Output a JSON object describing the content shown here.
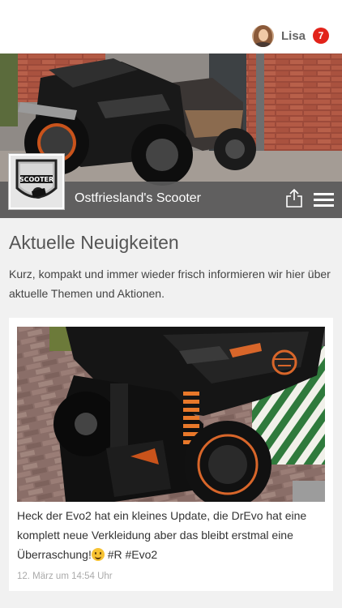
{
  "header": {
    "user_name": "Lisa",
    "notification_count": "7"
  },
  "page": {
    "name": "Ostfriesland's Scooter",
    "logo_text": "SCOOTER"
  },
  "news": {
    "title": "Aktuelle Neuigkeiten",
    "description": "Kurz, kompakt und immer wieder frisch informieren wir hier über aktuelle Themen und Aktionen."
  },
  "posts": [
    {
      "text_before_emoji": "Heck der Evo2 hat ein kleines Update, die DrEvo hat eine komplett neue Verkleidung aber das bleibt erstmal eine Überraschung!",
      "text_after_emoji": " #R #Evo2",
      "date": "12. März um 14:54 Uhr"
    }
  ],
  "colors": {
    "badge": "#e2231a",
    "cover_bar": "#5a5a5a",
    "background": "#f1f1f1"
  },
  "icons": {
    "share": "share-icon",
    "menu": "hamburger-menu-icon",
    "avatar": "avatar-image",
    "emoji": "smiling-face-emoji"
  }
}
